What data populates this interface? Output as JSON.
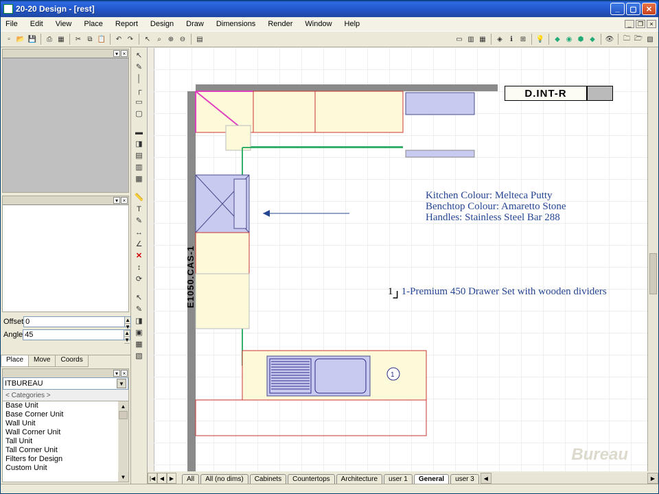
{
  "title": "20-20 Design - [rest]",
  "menu": [
    "File",
    "Edit",
    "View",
    "Place",
    "Report",
    "Design",
    "Draw",
    "Dimensions",
    "Render",
    "Window",
    "Help"
  ],
  "props": {
    "offset_label": "Offset",
    "offset_val": "0",
    "angle_label": "Angle",
    "angle_val": "45"
  },
  "prop_tabs": [
    "Place",
    "Move",
    "Coords"
  ],
  "catalog_name": "ITBUREAU",
  "categories_label": "< Categories >",
  "catalog_items": [
    "Base Unit",
    "Base Corner Unit",
    "Wall Unit",
    "Wall Corner Unit",
    "Tall Unit",
    "Tall Corner Unit",
    "Filters for Design",
    "Custom Unit"
  ],
  "bottom_tabs": [
    "All",
    "All (no dims)",
    "Cabinets",
    "Countertops",
    "Architecture",
    "user 1",
    "General",
    "user 3"
  ],
  "bottom_active": 6,
  "label_box": "D.INT-R",
  "anno_lines": [
    "Kitchen Colour: Melteca Putty",
    "Benchtop Colour: Amaretto Stone",
    "Handles: Stainless Steel Bar 288"
  ],
  "drawer_label": "1-Premium 450 Drawer Set with wooden dividers",
  "side_tag": "E1050.CAS-1",
  "watermark": "Bureau",
  "chart_data": null
}
